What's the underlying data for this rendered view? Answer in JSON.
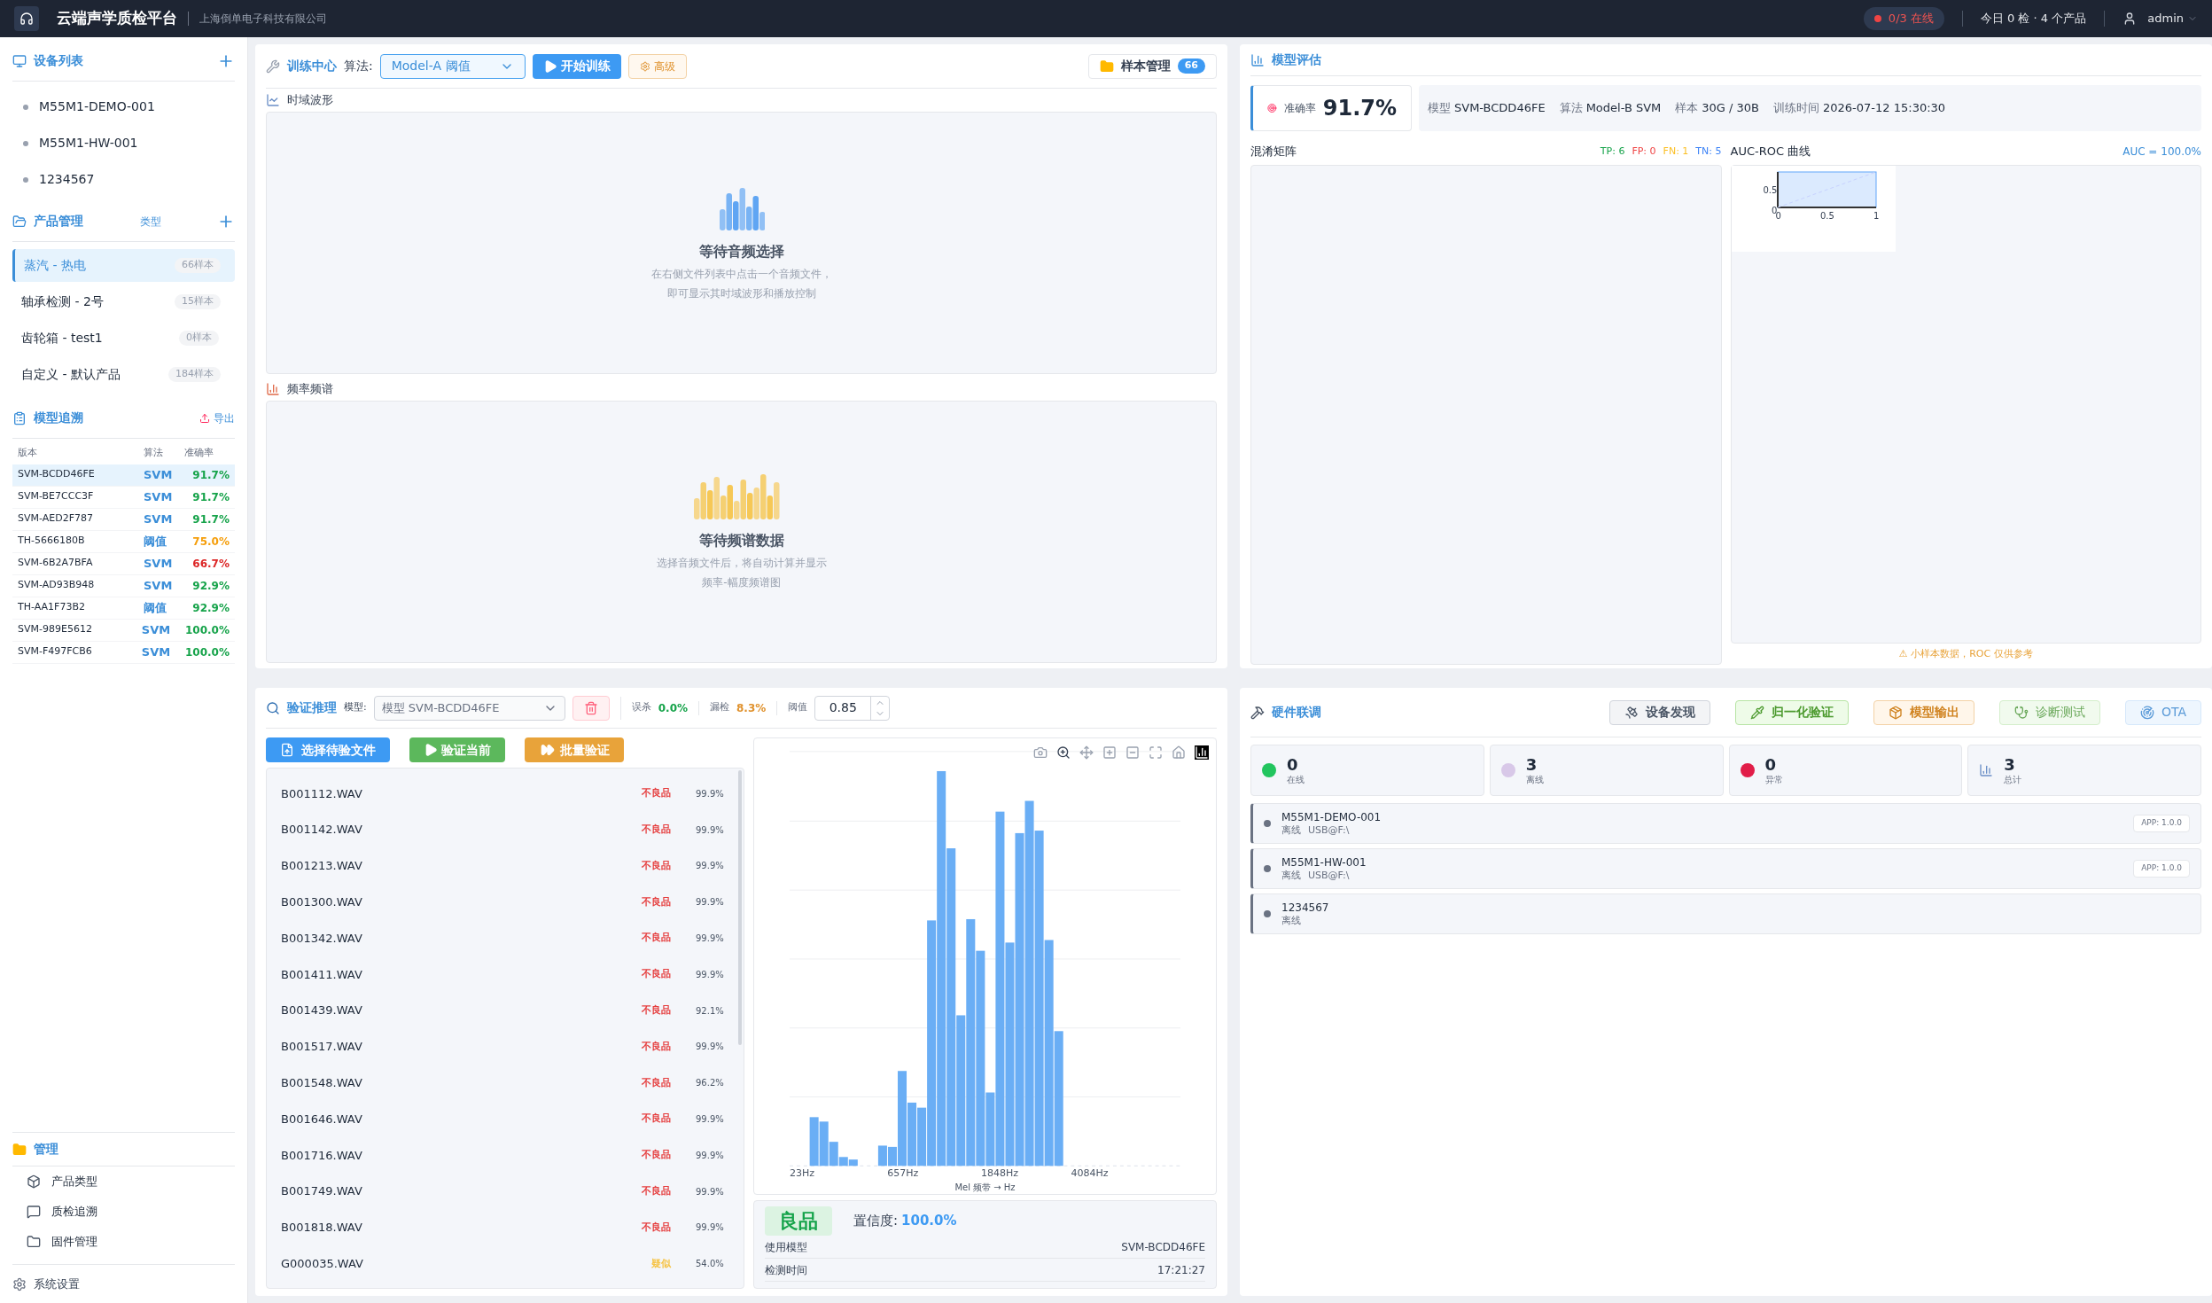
{
  "header": {
    "title": "云端声学质检平台",
    "company": "上海倒单电子科技有限公司",
    "online_status": "0/3 在线",
    "today": "今日 0 检 · 4 个产品",
    "user": "admin"
  },
  "sidebar": {
    "devices": {
      "title": "设备列表",
      "items": [
        "M55M1-DEMO-001",
        "M55M1-HW-001",
        "1234567"
      ]
    },
    "products": {
      "title": "产品管理",
      "type_link": "类型",
      "items": [
        {
          "name": "蒸汽 - 热电",
          "count": "66样本",
          "selected": true
        },
        {
          "name": "轴承检测 - 2号",
          "count": "15样本",
          "selected": false
        },
        {
          "name": "齿轮箱 - test1",
          "count": "0样本",
          "selected": false
        },
        {
          "name": "自定义 - 默认产品",
          "count": "184样本",
          "selected": false
        }
      ]
    },
    "models": {
      "title": "模型追溯",
      "export": "导出",
      "columns": [
        "版本",
        "算法",
        "准确率"
      ],
      "rows": [
        {
          "version": "SVM-BCDD46FE",
          "algo": "SVM",
          "accuracy": "91.7%",
          "color": "#16a34a",
          "selected": true
        },
        {
          "version": "SVM-BE7CCC3F",
          "algo": "SVM",
          "accuracy": "91.7%",
          "color": "#16a34a",
          "selected": false
        },
        {
          "version": "SVM-AED2F787",
          "algo": "SVM",
          "accuracy": "91.7%",
          "color": "#16a34a",
          "selected": false
        },
        {
          "version": "TH-5666180B",
          "algo": "阈值",
          "accuracy": "75.0%",
          "color": "#f59e0b",
          "selected": false
        },
        {
          "version": "SVM-6B2A7BFA",
          "algo": "SVM",
          "accuracy": "66.7%",
          "color": "#dc2626",
          "selected": false
        },
        {
          "version": "SVM-AD93B948",
          "algo": "SVM",
          "accuracy": "92.9%",
          "color": "#16a34a",
          "selected": false
        },
        {
          "version": "TH-AA1F73B2",
          "algo": "阈值",
          "accuracy": "92.9%",
          "color": "#16a34a",
          "selected": false
        },
        {
          "version": "SVM-989E5612",
          "algo": "SVM",
          "accuracy": "100.0%",
          "color": "#16a34a",
          "selected": false
        },
        {
          "version": "SVM-F497FCB6",
          "algo": "SVM",
          "accuracy": "100.0%",
          "color": "#16a34a",
          "selected": false
        }
      ]
    },
    "manage": {
      "title": "管理",
      "items": [
        {
          "label": "产品类型",
          "kind": "type"
        },
        {
          "label": "质检追溯",
          "kind": "trace"
        },
        {
          "label": "固件管理",
          "kind": "firmware"
        }
      ]
    },
    "settings": "系统设置"
  },
  "training": {
    "title": "训练中心",
    "algo_label": "算法:",
    "algo_value": "Model-A 阈值",
    "start": "开始训练",
    "advanced": "高级",
    "samples": "样本管理",
    "samples_count": "66",
    "waveform": {
      "label": "时域波形",
      "title": "等待音频选择",
      "desc": [
        "在右侧文件列表中点击一个音频文件，",
        "即可显示其时域波形和播放控制"
      ]
    },
    "spectrum": {
      "label": "频率频谱",
      "title": "等待频谱数据",
      "desc": [
        "选择音频文件后，将自动计算并显示",
        "频率-幅度频谱图"
      ]
    }
  },
  "evaluation": {
    "title": "模型评估",
    "accuracy_label": "准确率",
    "accuracy": "91.7%",
    "info": [
      {
        "label": "模型",
        "value": "SVM-BCDD46FE"
      },
      {
        "label": "算法",
        "value": "Model-B SVM"
      },
      {
        "label": "样本",
        "value": "30G / 30B"
      },
      {
        "label": "训练时间",
        "value": "2026-07-12 15:30:30"
      }
    ],
    "confusion_title": "混淆矩阵",
    "counts": [
      {
        "text": "TP: 6",
        "color": "#16a34a"
      },
      {
        "text": "FP: 0",
        "color": "#ef4444"
      },
      {
        "text": "FN: 1",
        "color": "#fbbf24"
      },
      {
        "text": "TN: 5",
        "color": "#3b82f6"
      }
    ],
    "roc_title": "AUC-ROC 曲线",
    "auc": "AUC = 100.0%",
    "roc_yticks": [
      "0.5",
      "0"
    ],
    "roc_xticks": [
      "0",
      "0.5",
      "1"
    ],
    "note": "⚠ 小样本数据，ROC 仅供参考"
  },
  "verify": {
    "title": "验证推理",
    "model_label": "模型:",
    "model_value": "模型 SVM-BCDD46FE",
    "model_disabled": true,
    "false_kill_label": "误杀",
    "false_kill": "0.0%",
    "miss_label": "漏检",
    "miss": "8.3%",
    "threshold_label": "阈值",
    "threshold": "0.85",
    "choose": "选择待验文件",
    "verify_current": "验证当前",
    "batch": "批量验证",
    "files": [
      {
        "name": "B001112.WAV",
        "result": "不良品",
        "kind": "bad",
        "score": "99.9%"
      },
      {
        "name": "B001142.WAV",
        "result": "不良品",
        "kind": "bad",
        "score": "99.9%"
      },
      {
        "name": "B001213.WAV",
        "result": "不良品",
        "kind": "bad",
        "score": "99.9%"
      },
      {
        "name": "B001300.WAV",
        "result": "不良品",
        "kind": "bad",
        "score": "99.9%"
      },
      {
        "name": "B001342.WAV",
        "result": "不良品",
        "kind": "bad",
        "score": "99.9%"
      },
      {
        "name": "B001411.WAV",
        "result": "不良品",
        "kind": "bad",
        "score": "99.9%"
      },
      {
        "name": "B001439.WAV",
        "result": "不良品",
        "kind": "bad",
        "score": "92.1%"
      },
      {
        "name": "B001517.WAV",
        "result": "不良品",
        "kind": "bad",
        "score": "99.9%"
      },
      {
        "name": "B001548.WAV",
        "result": "不良品",
        "kind": "bad",
        "score": "96.2%"
      },
      {
        "name": "B001646.WAV",
        "result": "不良品",
        "kind": "bad",
        "score": "99.9%"
      },
      {
        "name": "B001716.WAV",
        "result": "不良品",
        "kind": "bad",
        "score": "99.9%"
      },
      {
        "name": "B001749.WAV",
        "result": "不良品",
        "kind": "bad",
        "score": "99.9%"
      },
      {
        "name": "B001818.WAV",
        "result": "不良品",
        "kind": "bad",
        "score": "99.9%"
      },
      {
        "name": "G000035.WAV",
        "result": "疑似",
        "kind": "suspect",
        "score": "54.0%"
      }
    ],
    "xticks": [
      "23Hz",
      "657Hz",
      "1848Hz",
      "4084Hz"
    ],
    "xlabel": "Mel 频带 → Hz",
    "result": "良品",
    "confidence_label": "置信度:",
    "confidence": "100.0%",
    "details": [
      {
        "label": "使用模型",
        "value": "SVM-BCDD46FE"
      },
      {
        "label": "检测时间",
        "value": "17:21:27"
      }
    ]
  },
  "hardware": {
    "title": "硬件联调",
    "buttons": [
      {
        "label": "设备发现",
        "kind": "discover",
        "disabled": false
      },
      {
        "label": "归一化验证",
        "kind": "normalize",
        "disabled": false
      },
      {
        "label": "模型输出",
        "kind": "export",
        "disabled": false
      },
      {
        "label": "诊断测试",
        "kind": "diagnose",
        "disabled": true
      },
      {
        "label": "OTA",
        "kind": "ota",
        "disabled": true
      }
    ],
    "stats": [
      {
        "value": "0",
        "label": "在线",
        "kind": "dot",
        "color": "#22c55e"
      },
      {
        "value": "3",
        "label": "离线",
        "kind": "dot",
        "color": "#d8c8e8"
      },
      {
        "value": "0",
        "label": "异常",
        "kind": "dot",
        "color": "#e11d48"
      },
      {
        "value": "3",
        "label": "总计",
        "kind": "chart"
      }
    ],
    "devices": [
      {
        "name": "M55M1-DEMO-001",
        "status": "离线",
        "port": "USB@F:\\",
        "app": "APP: 1.0.0"
      },
      {
        "name": "M55M1-HW-001",
        "status": "离线",
        "port": "USB@F:\\",
        "app": "APP: 1.0.0"
      },
      {
        "name": "1234567",
        "status": "离线"
      }
    ]
  }
}
